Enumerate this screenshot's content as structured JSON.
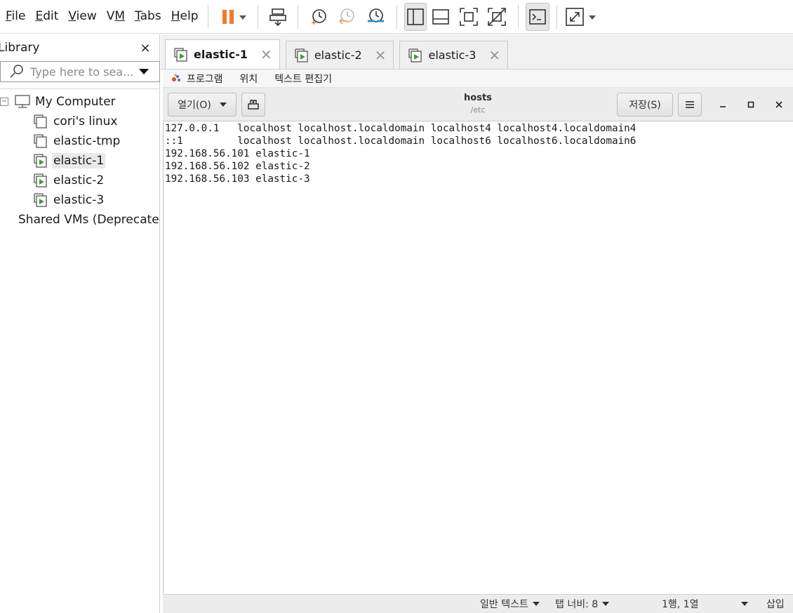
{
  "menubar": {
    "file": {
      "u": "F",
      "rest": "ile"
    },
    "edit": {
      "u": "E",
      "rest": "dit"
    },
    "view": {
      "u": "V",
      "rest": "iew"
    },
    "vm": {
      "pre": "V",
      "u": "M",
      "rest": ""
    },
    "tabs": {
      "u": "T",
      "rest": "abs"
    },
    "help": {
      "u": "H",
      "rest": "elp"
    }
  },
  "toolbar": {
    "pause_color": "#f07b28",
    "icons": [
      "pause-icon",
      "send-keys-icon",
      "snapshot-take-icon",
      "snapshot-revert-icon",
      "snapshot-manager-icon",
      "library-toggle-icon",
      "thumbnail-bar-icon",
      "fullscreen-icon",
      "unity-icon",
      "console-view-icon",
      "stretch-guest-icon"
    ]
  },
  "library": {
    "title": "Library",
    "close": "×",
    "search_placeholder": "Type here to sea...",
    "tree": {
      "root": "My Computer",
      "items": [
        "cori's linux",
        "elastic-tmp",
        "elastic-1",
        "elastic-2",
        "elastic-3"
      ],
      "selected": "elastic-1",
      "shared": "Shared VMs (Deprecated)"
    }
  },
  "vm_tabs": [
    {
      "label": "elastic-1",
      "active": true
    },
    {
      "label": "elastic-2",
      "active": false
    },
    {
      "label": "elastic-3",
      "active": false
    }
  ],
  "tab_close": "✕",
  "gnome_bar": {
    "programs": "프로그램",
    "places": "위치",
    "app": "텍스트 편집기"
  },
  "gedit": {
    "open_button": "열기(O)",
    "save_button": "저장(S)",
    "doc_name": "hosts",
    "doc_path": "/etc",
    "lines": [
      "127.0.0.1   localhost localhost.localdomain localhost4 localhost4.localdomain4",
      "::1         localhost localhost.localdomain localhost6 localhost6.localdomain6",
      "192.168.56.101 elastic-1",
      "192.168.56.102 elastic-2",
      "192.168.56.103 elastic-3"
    ],
    "status": {
      "language": "일반 텍스트",
      "tab_width": "탭 너비: 8",
      "position": "1행, 1열",
      "mode": "삽입"
    }
  },
  "colors": {
    "vm_running_green": "#3aa02e",
    "accent_orange": "#f07b28"
  }
}
